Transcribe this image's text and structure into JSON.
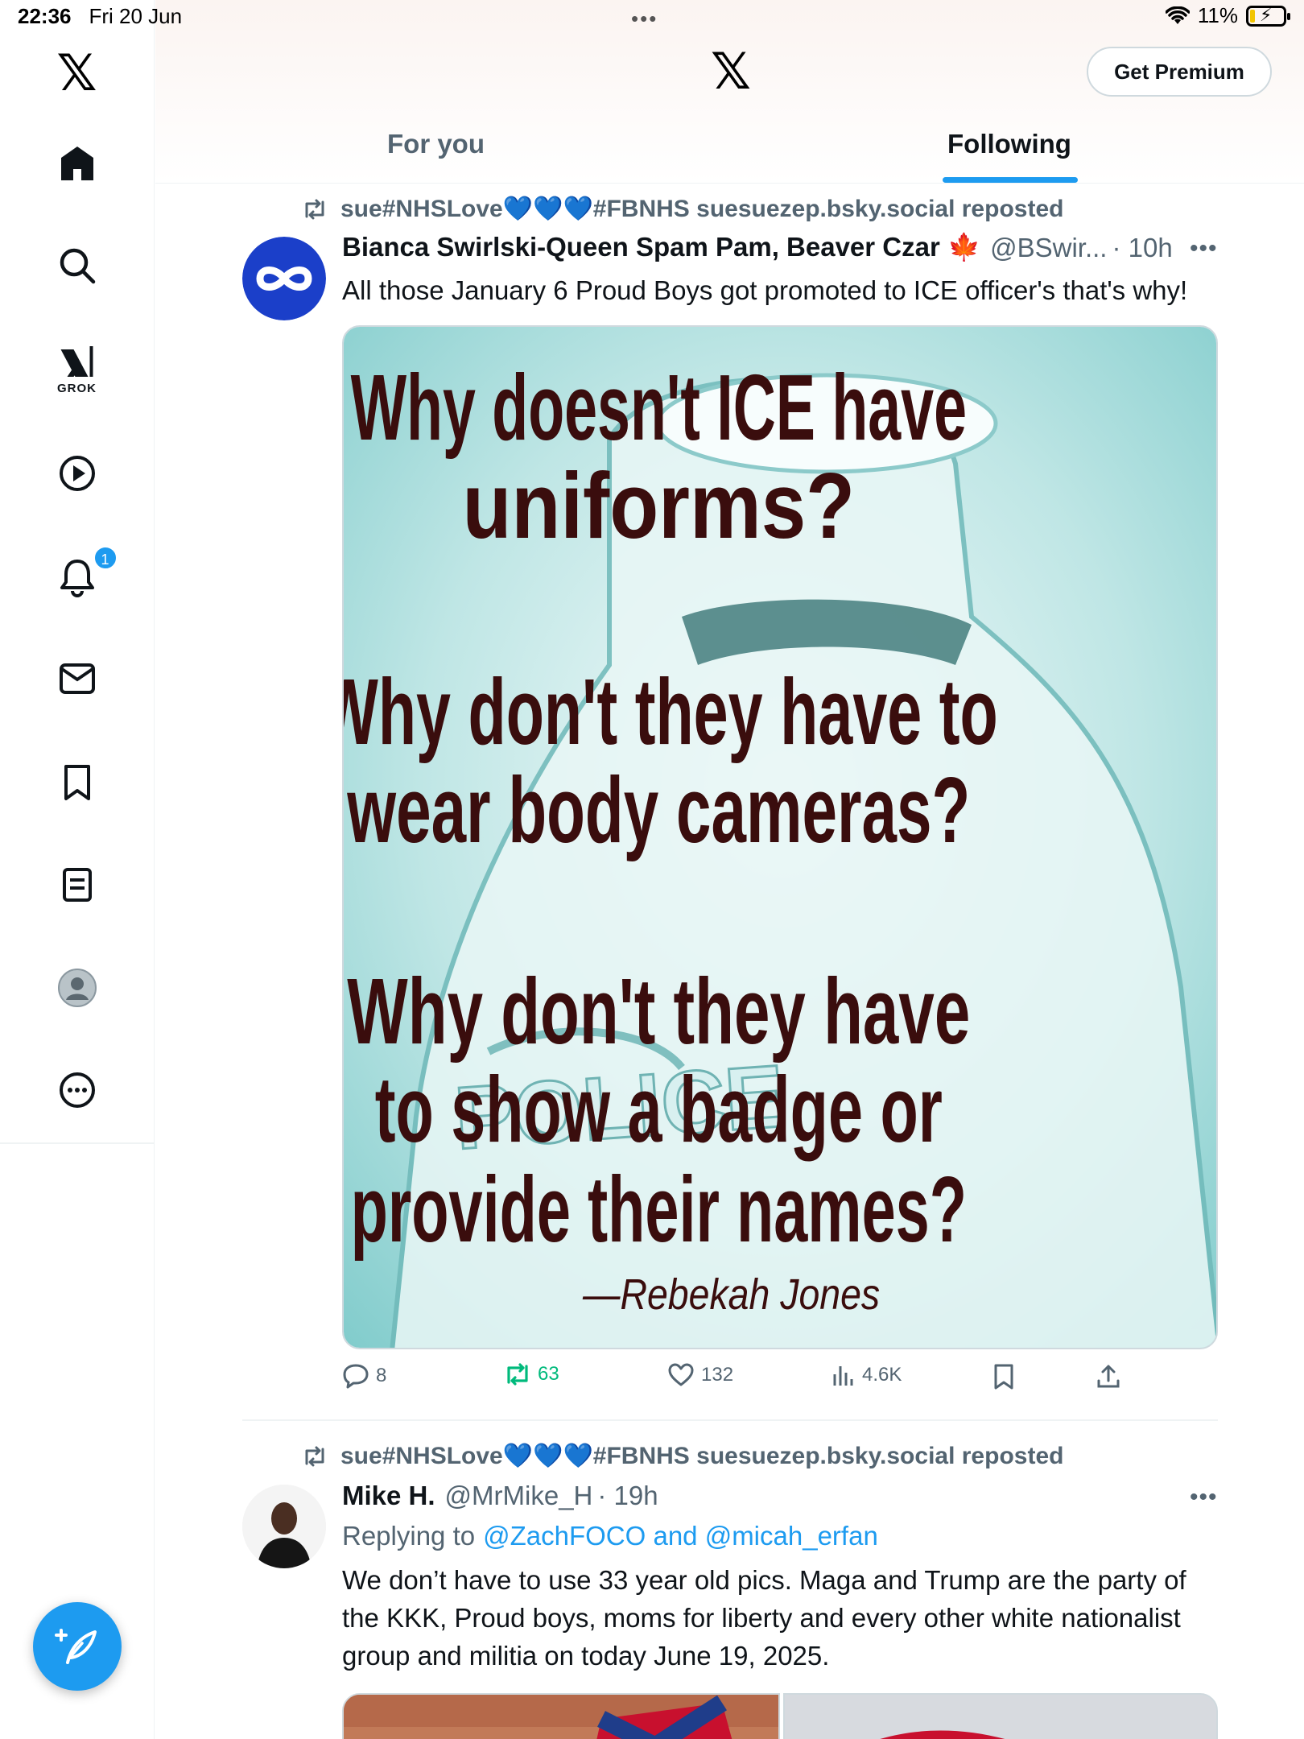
{
  "status_bar": {
    "time": "22:36",
    "date": "Fri 20 Jun",
    "dots": "•••",
    "battery": "11%"
  },
  "sidebar": {
    "items": [
      {
        "name": "home",
        "icon": "home-icon"
      },
      {
        "name": "explore",
        "icon": "search-icon"
      },
      {
        "name": "grok",
        "icon": "grok-icon",
        "label": "GROK"
      },
      {
        "name": "videos",
        "icon": "play-icon"
      },
      {
        "name": "notifications",
        "icon": "bell-icon",
        "badge": "1"
      },
      {
        "name": "messages",
        "icon": "mail-icon"
      },
      {
        "name": "bookmarks",
        "icon": "bookmark-icon"
      },
      {
        "name": "lists",
        "icon": "list-icon"
      },
      {
        "name": "profile",
        "icon": "profile-icon"
      },
      {
        "name": "more",
        "icon": "more-icon"
      }
    ]
  },
  "header": {
    "logo": "𝕏",
    "premium_label": "Get Premium",
    "tabs": [
      {
        "label": "For you",
        "active": false
      },
      {
        "label": "Following",
        "active": true
      }
    ]
  },
  "colors": {
    "accent": "#1d9bf0",
    "repost_green": "#00ba7c",
    "secondary_text": "#536471"
  },
  "tweets": [
    {
      "reposted_by": "sue#NHSLove💙💙💙#FBNHS suesuezep.bsky.social reposted",
      "name": "Bianca Swirlski-Queen Spam Pam, Beaver Czar 🍁",
      "handle": "@BSwir...",
      "time": "· 10h",
      "text": "All those January 6 Proud Boys got promoted to ICE officer's that's why!",
      "image_text": {
        "line1": "Why doesn't ICE have",
        "line2": "uniforms?",
        "line3": "Why don't they have to",
        "line4": "wear body cameras?",
        "line5": "Why don't they have",
        "line6": "to show a badge or",
        "line7": "provide their names?",
        "attribution": "—Rebekah Jones",
        "background_text": "POLICE"
      },
      "stats": {
        "replies": "8",
        "reposts": "63",
        "likes": "132",
        "views": "4.6K"
      }
    },
    {
      "reposted_by": "sue#NHSLove💙💙💙#FBNHS suesuezep.bsky.social reposted",
      "name": "Mike H.",
      "handle": "@MrMike_H",
      "time": "· 19h",
      "replying_prefix": "Replying to",
      "replying_to": "@ZachFOCO and @micah_erfan",
      "text": "We don’t have to use 33 year old pics. Maga and Trump are the party of the KKK, Proud boys, moms for liberty and every other white nationalist group and militia on today June 19, 2025."
    }
  ]
}
